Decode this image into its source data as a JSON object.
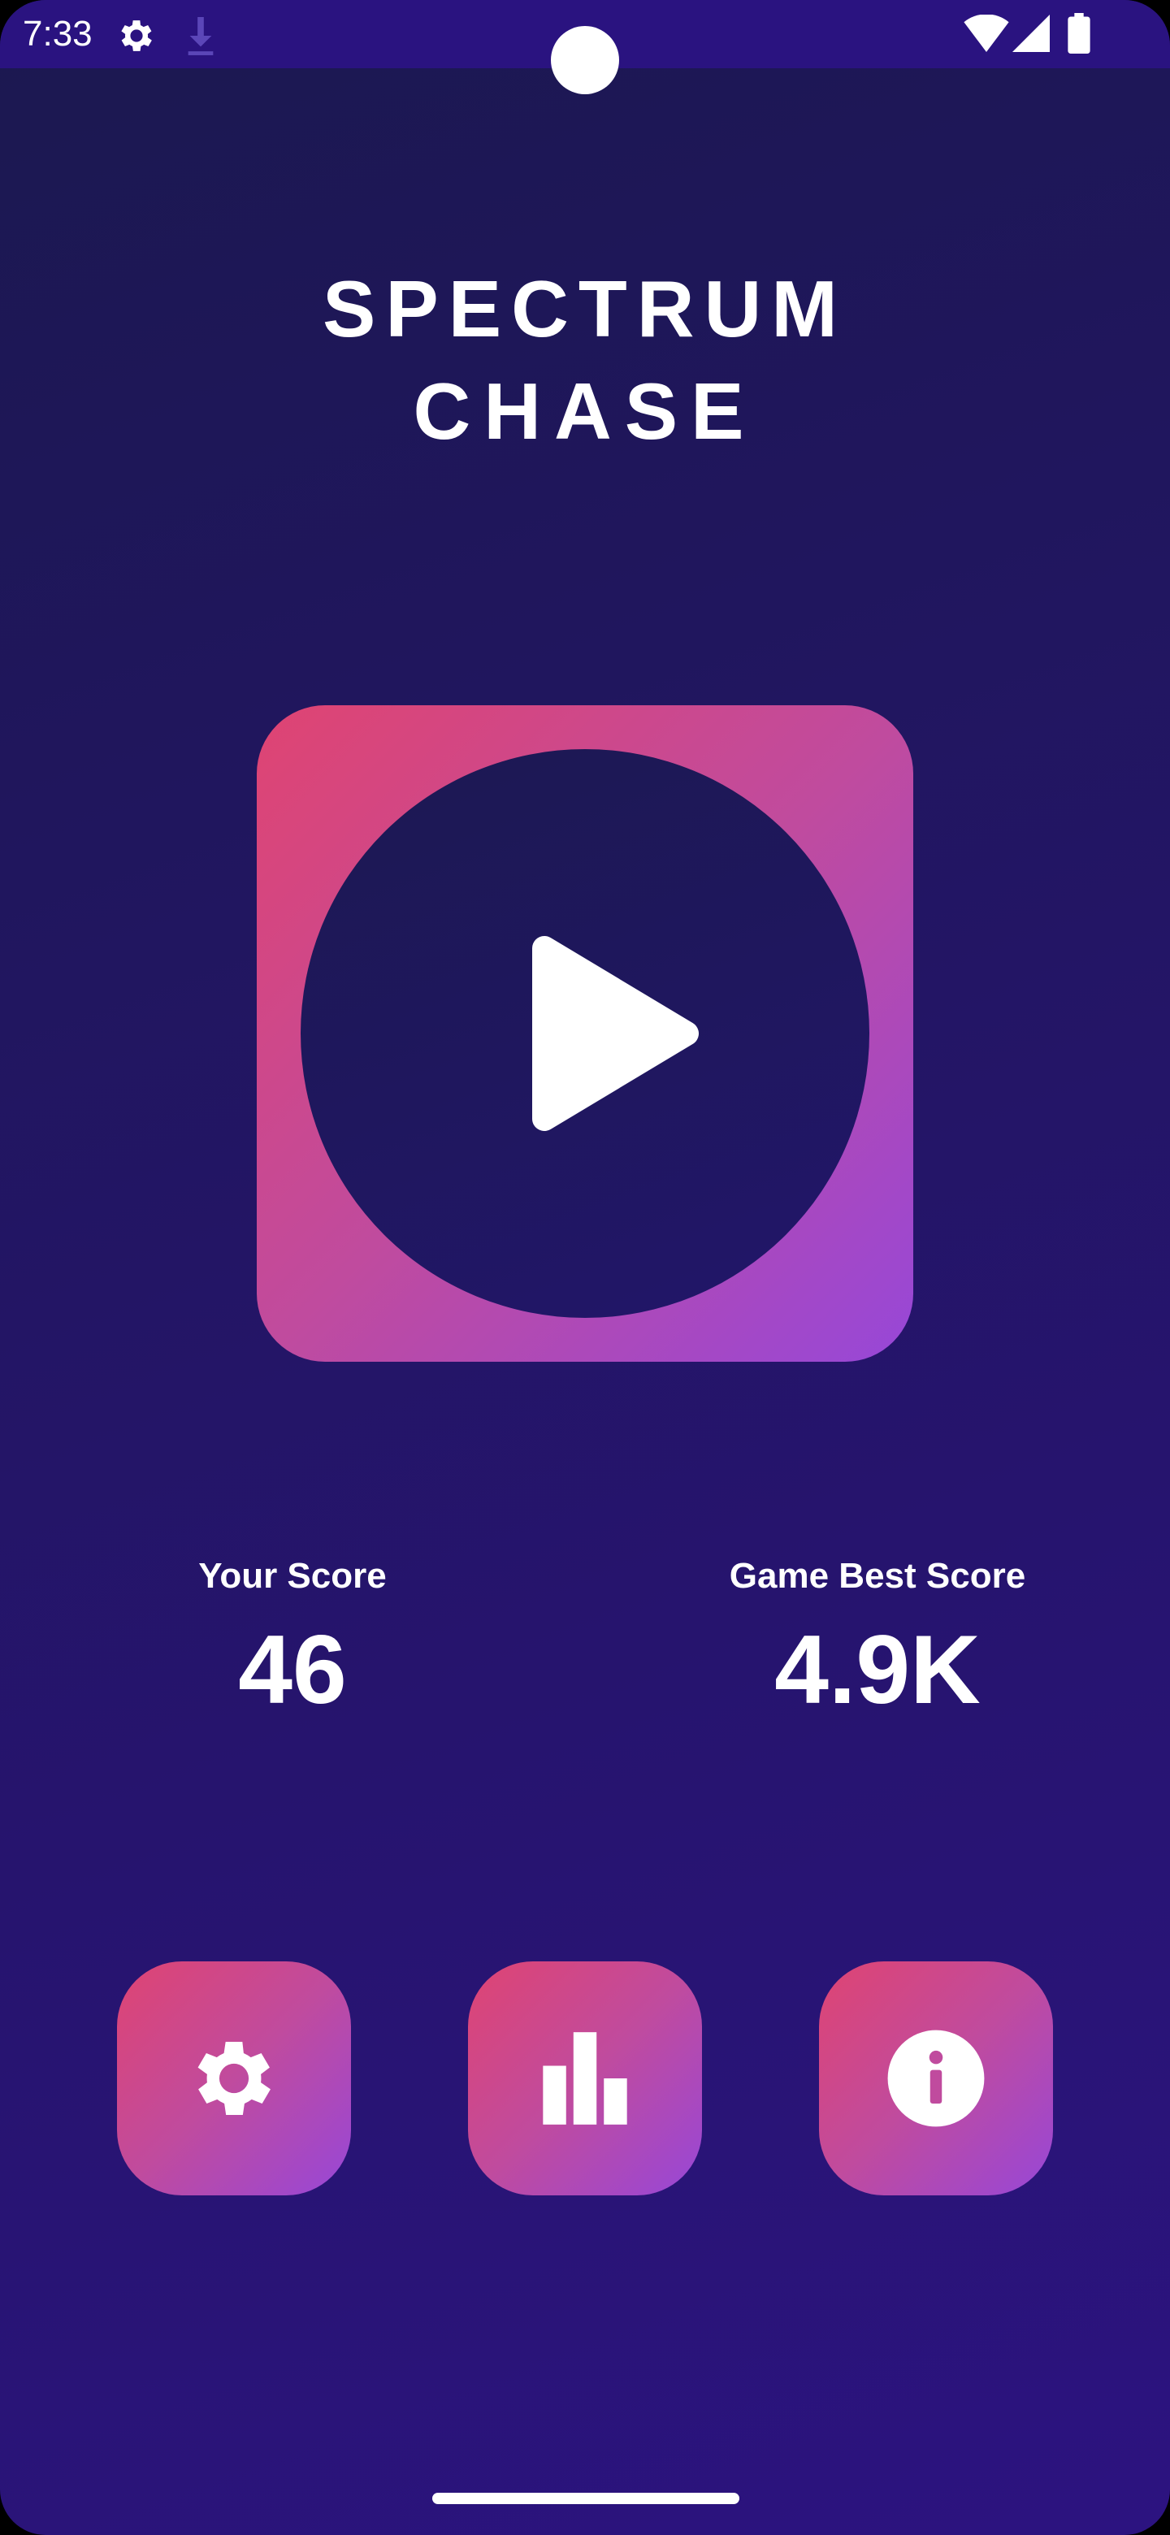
{
  "status_bar": {
    "time": "7:33",
    "icons": [
      "gear-icon",
      "download-icon",
      "wifi-icon",
      "signal-icon",
      "battery-icon"
    ]
  },
  "logo": {
    "line1": "SPECTRUM",
    "line2": "CHASE"
  },
  "play": {
    "icon": "play-icon"
  },
  "scores": {
    "your_score_label": "Your Score",
    "your_score_value": "46",
    "best_score_label": "Game Best Score",
    "best_score_value": "4.9K"
  },
  "menu": {
    "buttons": [
      {
        "icon": "gear-icon"
      },
      {
        "icon": "bar-chart-icon"
      },
      {
        "icon": "info-icon"
      }
    ]
  },
  "colors": {
    "background_top": "#1b1850",
    "background_bottom": "#2c1380",
    "status_bar": "#2a1380",
    "accent_pink": "#df4472",
    "accent_purple": "#9747d8",
    "text": "#ffffff"
  }
}
